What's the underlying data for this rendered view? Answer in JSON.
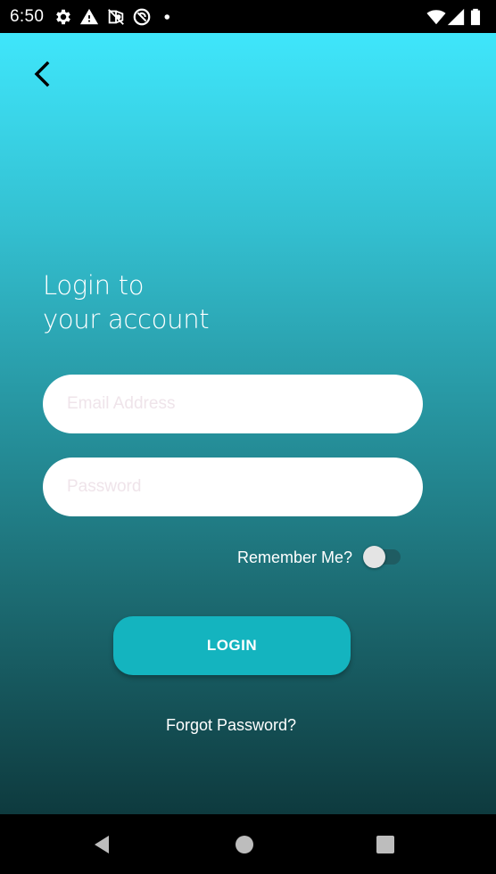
{
  "status_bar": {
    "time": "6:50",
    "icons": [
      "settings-icon",
      "warning-icon",
      "location-off-icon",
      "no-disturb-icon",
      "dot-icon",
      "wifi-icon",
      "signal-icon",
      "battery-icon"
    ]
  },
  "header": {
    "back_icon": "chevron-left-icon"
  },
  "login": {
    "title_line1": "Login to",
    "title_line2": "your account",
    "email_placeholder": "Email Address",
    "email_value": "",
    "password_placeholder": "Password",
    "password_value": "",
    "remember_label": "Remember Me?",
    "remember_checked": false,
    "login_button": "LOGIN",
    "forgot_link": "Forgot Password?"
  },
  "nav_bar": {
    "icons": [
      "back-triangle-icon",
      "home-circle-icon",
      "recents-square-icon"
    ]
  },
  "colors": {
    "gradient_top": "#3fe6fb",
    "gradient_bottom": "#0e3a3e",
    "button": "#14b4bf",
    "placeholder": "#efe4ea"
  }
}
